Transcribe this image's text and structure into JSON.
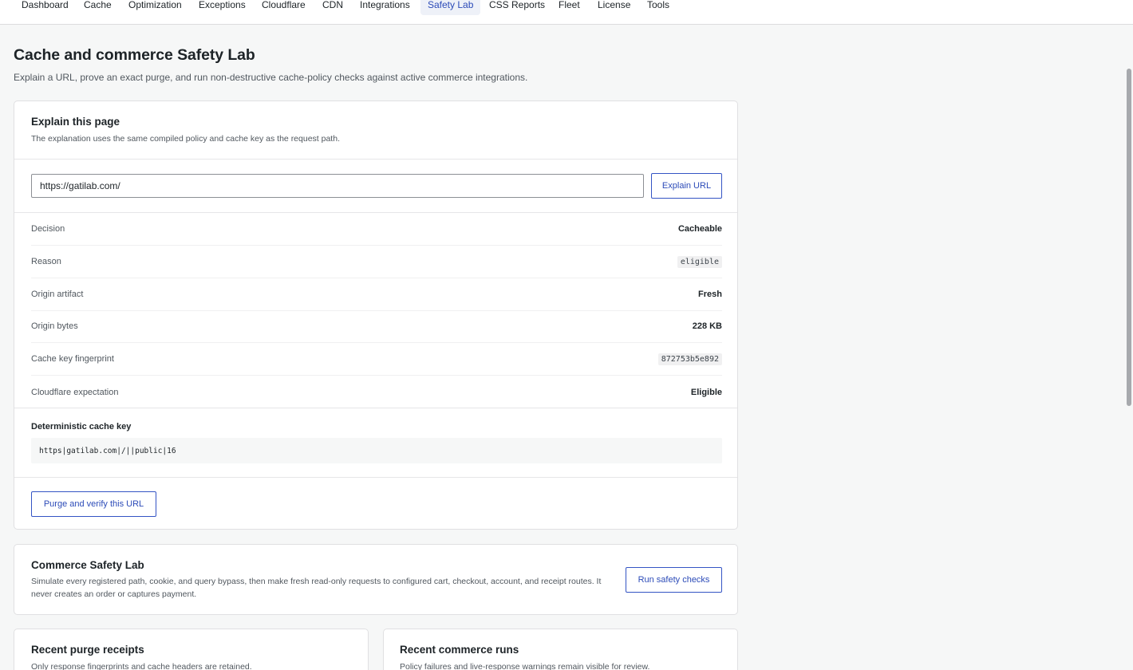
{
  "nav": {
    "tabs": [
      {
        "label": "Dashboard"
      },
      {
        "label": "Cache"
      },
      {
        "label": "Optimization"
      },
      {
        "label": "Exceptions"
      },
      {
        "label": "Cloudflare"
      },
      {
        "label": "CDN"
      },
      {
        "label": "Integrations"
      },
      {
        "label": "Safety Lab",
        "active": true
      },
      {
        "label": "CSS Reports"
      },
      {
        "label": "Fleet"
      },
      {
        "label": "License"
      },
      {
        "label": "Tools"
      }
    ]
  },
  "page": {
    "title": "Cache and commerce Safety Lab",
    "subtitle": "Explain a URL, prove an exact purge, and run non-destructive cache-policy checks against active commerce integrations."
  },
  "explain": {
    "title": "Explain this page",
    "description": "The explanation uses the same compiled policy and cache key as the request path.",
    "url_value": "https://gatilab.com/",
    "explain_button": "Explain URL",
    "rows": [
      {
        "label": "Decision",
        "value": "Cacheable",
        "code": false
      },
      {
        "label": "Reason",
        "value": "eligible",
        "code": true
      },
      {
        "label": "Origin artifact",
        "value": "Fresh",
        "code": false
      },
      {
        "label": "Origin bytes",
        "value": "228 KB",
        "code": false
      },
      {
        "label": "Cache key fingerprint",
        "value": "872753b5e892",
        "code": true
      },
      {
        "label": "Cloudflare expectation",
        "value": "Eligible",
        "code": false
      }
    ],
    "cache_key_label": "Deterministic cache key",
    "cache_key_value": "https|gatilab.com|/||public|16",
    "purge_button": "Purge and verify this URL"
  },
  "commerce": {
    "title": "Commerce Safety Lab",
    "description": "Simulate every registered path, cookie, and query bypass, then make fresh read-only requests to configured cart, checkout, account, and receipt routes. It never creates an order or captures payment.",
    "run_button": "Run safety checks"
  },
  "purge_receipts": {
    "title": "Recent purge receipts",
    "description": "Only response fingerprints and cache headers are retained."
  },
  "commerce_runs": {
    "title": "Recent commerce runs",
    "description": "Policy failures and live-response warnings remain visible for review."
  }
}
